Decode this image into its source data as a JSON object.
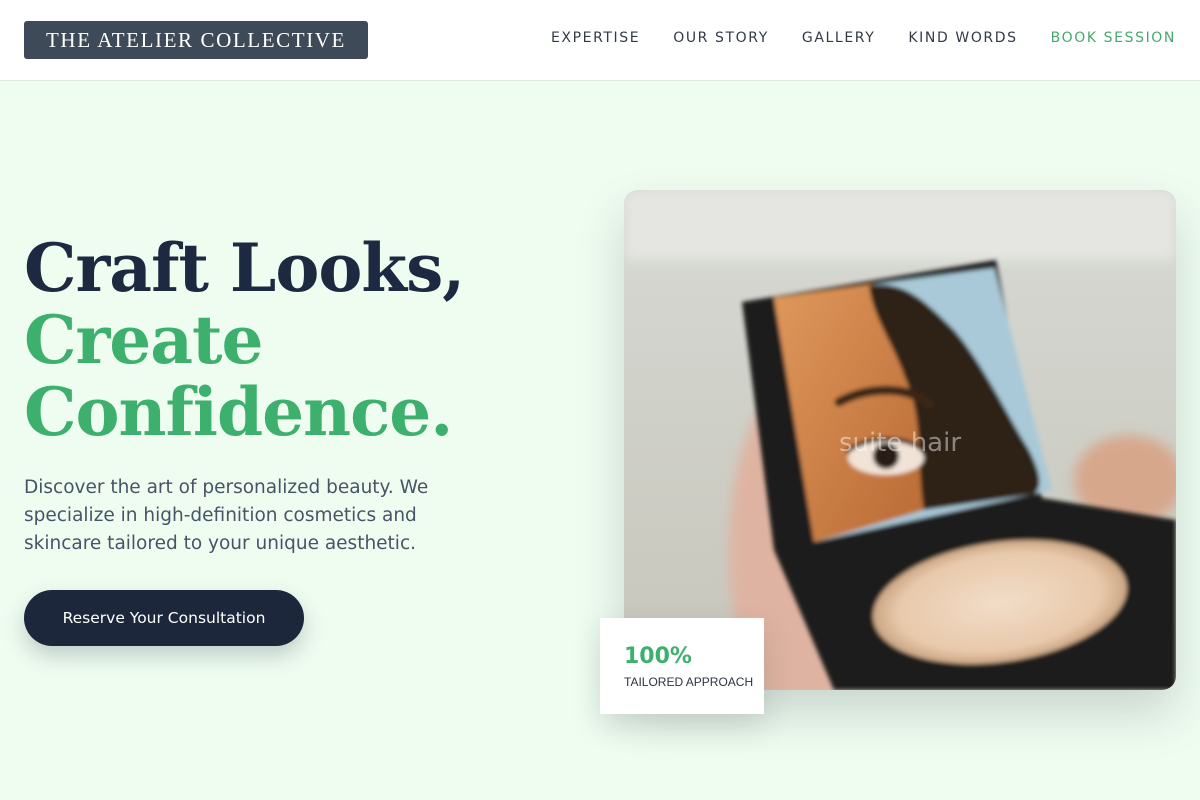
{
  "header": {
    "logo": "THE ATELIER COLLECTIVE",
    "nav": [
      {
        "label": "EXPERTISE"
      },
      {
        "label": "OUR STORY"
      },
      {
        "label": "GALLERY"
      },
      {
        "label": "KIND WORDS"
      },
      {
        "label": "BOOK SESSION"
      }
    ]
  },
  "hero": {
    "headline_line1": "Craft Looks,",
    "headline_line2": "Create",
    "headline_line3": "Confidence.",
    "lead": "Discover the art of personalized beauty. We specialize in high-definition cosmetics and skincare tailored to your unique aesthetic.",
    "cta_label": "Reserve Your Consultation",
    "image_caption": "suite hair",
    "stat": {
      "value": "100%",
      "label": "TAILORED APPROACH"
    }
  },
  "colors": {
    "page_background": "#effdf1",
    "accent_green": "#3eb06d",
    "navy": "#1c273c",
    "logo_background": "#3f4a59"
  }
}
